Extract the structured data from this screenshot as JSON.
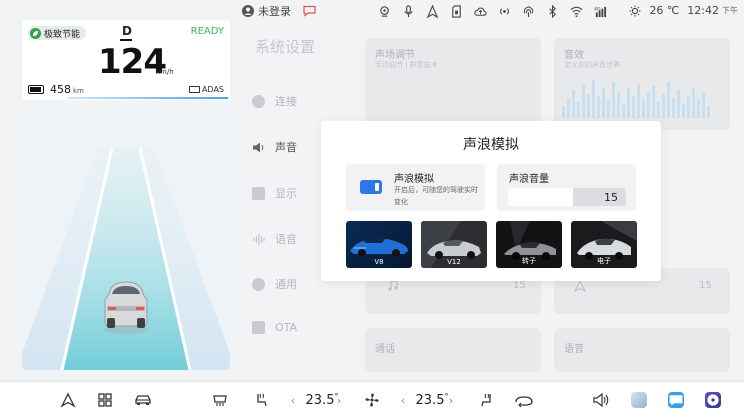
{
  "status_bar": {
    "login_text": "未登录",
    "temperature": "26 ℃",
    "time": "12:42",
    "period": "下午",
    "icons": [
      "avatar-icon",
      "message-icon",
      "location-icon",
      "microphone-icon",
      "navigation-icon",
      "sim-icon",
      "cloud-icon",
      "radio-icon",
      "hotspot-icon",
      "bluetooth-icon",
      "wifi-icon",
      "signal-icon",
      "brightness-icon"
    ]
  },
  "cluster": {
    "eco_mode": "极致节能",
    "gear": "D",
    "ready": "READY",
    "speed": "124",
    "speed_unit": "km/h",
    "range": "458",
    "range_unit": "km",
    "adas": "ADAS"
  },
  "settings": {
    "title": "系统设置",
    "nav": [
      "连接",
      "声音",
      "显示",
      "语音",
      "通用",
      "OTA"
    ],
    "cards": {
      "sound_field": {
        "title": "声场调节",
        "subtitle": "手动调节 | 群享技术"
      },
      "sound_effect": {
        "title": "音效",
        "subtitle": "定义你的声音世界"
      },
      "card3_value": "15",
      "card4_value": "15",
      "call": {
        "title": "通话"
      },
      "voice": {
        "title": "语音"
      }
    }
  },
  "modal": {
    "title": "声浪模拟",
    "switch": {
      "title": "声浪模拟",
      "description": "开启后，可随您的驾驶实时变化",
      "enabled": true
    },
    "volume": {
      "title": "声浪音量",
      "value": "15",
      "level_fraction": 0.55
    },
    "presets": [
      {
        "label": "V8",
        "selected": true
      },
      {
        "label": "V12",
        "selected": false
      },
      {
        "label": "转子",
        "selected": false
      },
      {
        "label": "电子",
        "selected": false
      }
    ]
  },
  "dock": {
    "left_temp": "23.5",
    "right_temp": "23.5",
    "temp_unit": "°",
    "accent": "#2d77e6"
  }
}
